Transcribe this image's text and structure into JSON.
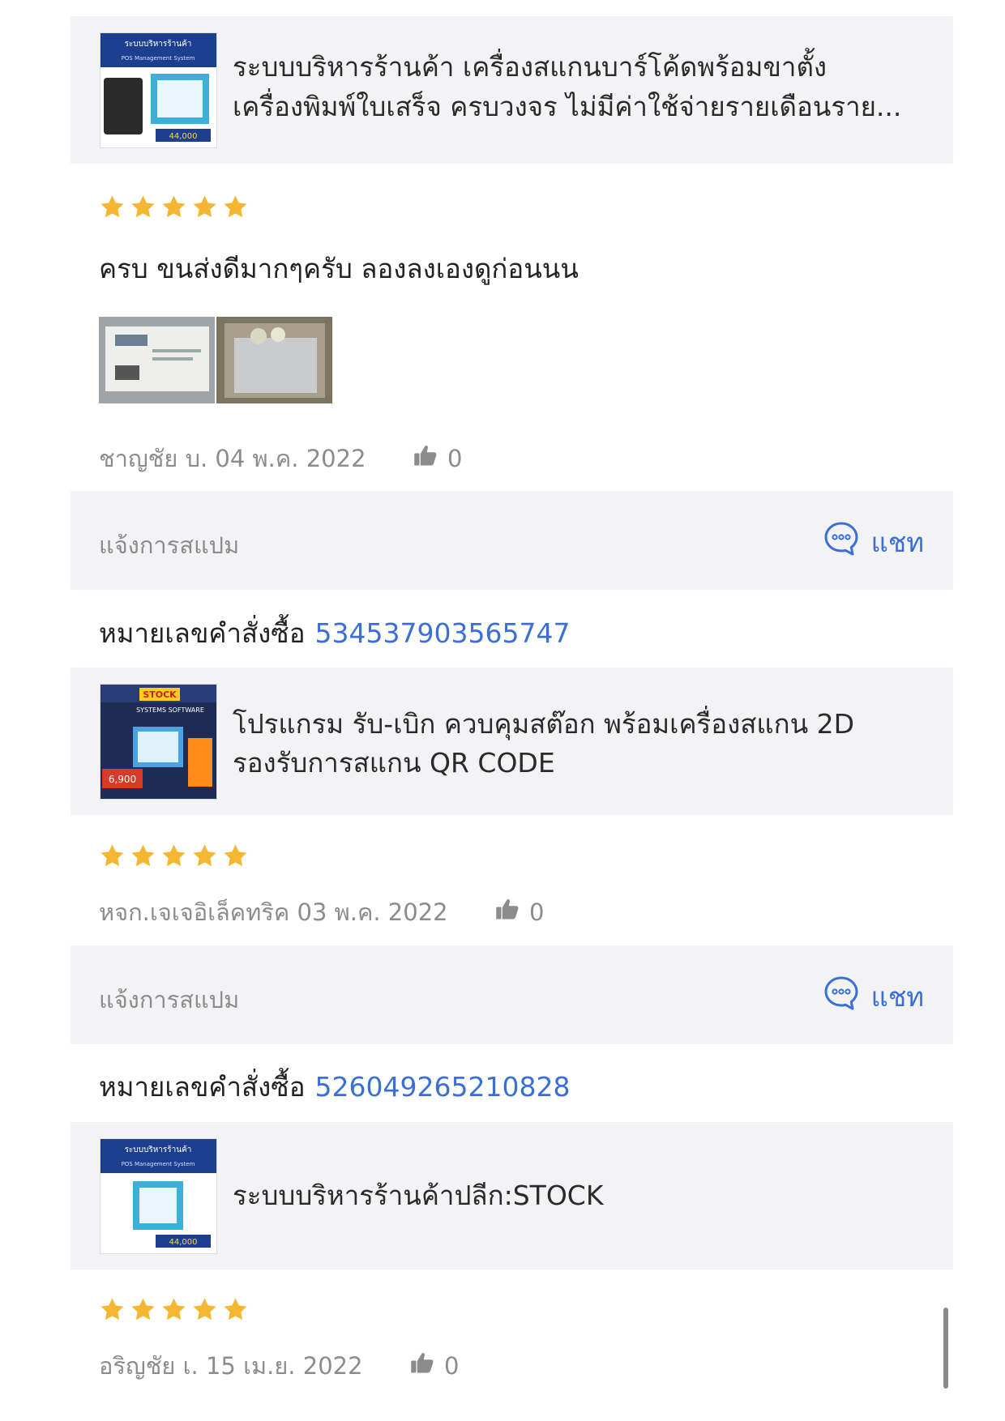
{
  "reviews": [
    {
      "product_title_1": "ระบบบริหารร้านค้า เครื่องสแกนบาร์โค้ดพร้อมขาตั้ง",
      "product_title_2": "เครื่องพิมพ์ใบเสร็จ ครบวงจร ไม่มีค่าใช้จ่ายรายเดือนราย...",
      "thumb_text_1": "ระบบบริหารร้านค้า",
      "thumb_text_2": "POS Management System",
      "thumb_price": "44,000",
      "rating": 5,
      "text": "ครบ ขนส่งดีมากๆครับ  ลองลงเองดูก่อนนน",
      "reviewer": "ชาญชัย บ.",
      "date": "04 พ.ค. 2022",
      "likes": "0"
    },
    {
      "product_title_1": "โปรแกรม รับ-เบิก ควบคุมสต๊อก พร้อมเครื่องสแกน 2D",
      "product_title_2": "รองรับการสแกน QR CODE",
      "thumb_text_1": "STOCK",
      "thumb_text_2": "SYSTEMS SOFTWARE",
      "thumb_price": "6,900",
      "rating": 5,
      "reviewer": "หจก.เจเจอิเล็คทริค",
      "date": "03 พ.ค. 2022",
      "likes": "0"
    },
    {
      "product_title_1": "ระบบบริหารร้านค้าปลีก:STOCK",
      "thumb_text_1": "ระบบบริหารร้านค้า",
      "thumb_text_2": "POS Management System",
      "thumb_price": "44,000",
      "rating": 5,
      "reviewer": "อริญชัย เ.",
      "date": "15 เม.ย. 2022",
      "likes": "0"
    }
  ],
  "actions": {
    "spam_label": "แจ้งการสแปม",
    "chat_label": "แชท"
  },
  "orders": [
    {
      "label": "หมายเลขคำสั่งซื้อ",
      "id": "534537903565747"
    },
    {
      "label": "หมายเลขคำสั่งซื้อ",
      "id": "526049265210828"
    }
  ],
  "colors": {
    "star": "#f5b731",
    "link": "#3a6fd6",
    "muted": "#8c8c8c",
    "panel": "#f3f3f5"
  }
}
